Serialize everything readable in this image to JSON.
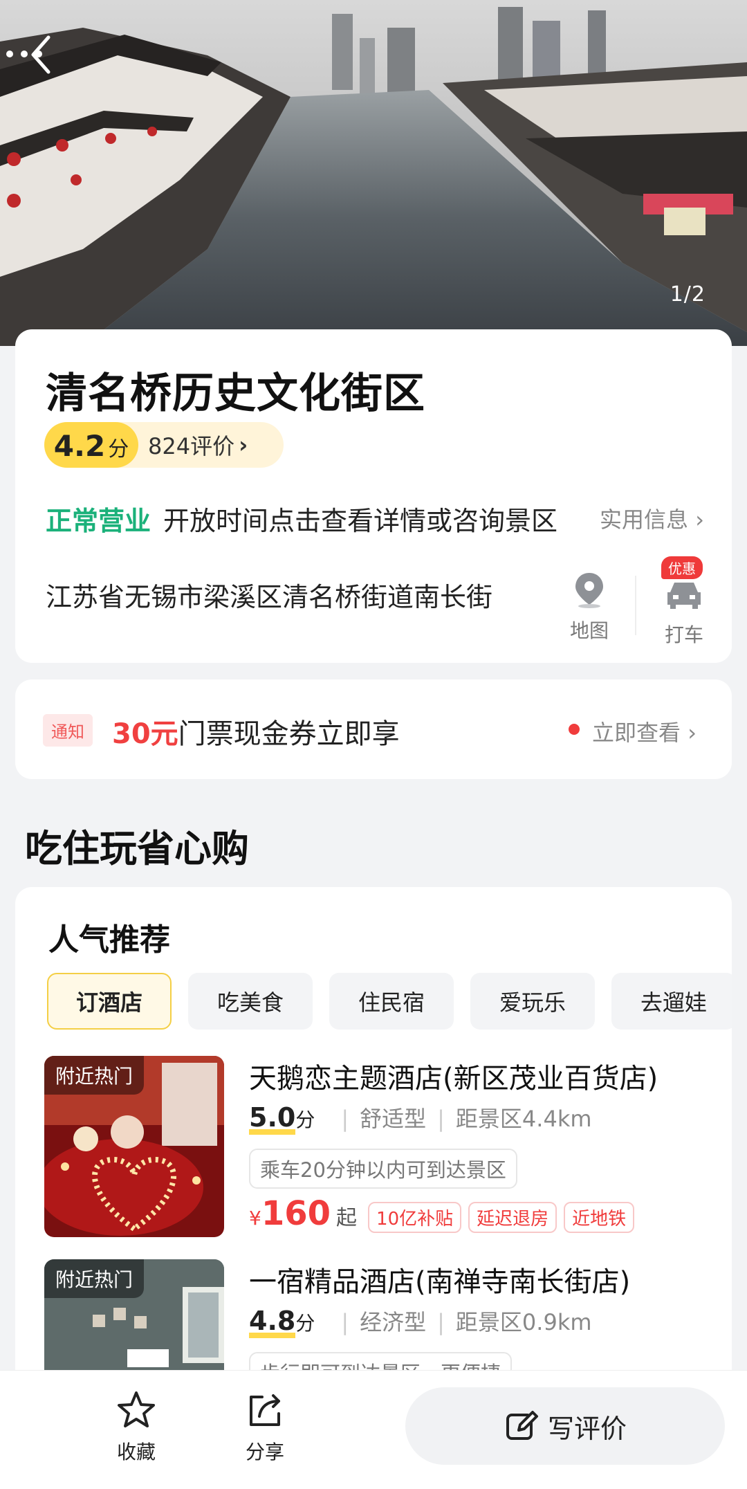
{
  "hero": {
    "counter": "1/2",
    "back_icon": "back-arrow-icon",
    "more_icon": "more-dots-icon"
  },
  "info": {
    "title": "清名桥历史文化街区",
    "rating": "4.2",
    "rating_unit": "分",
    "reviews": "824评价",
    "status": "正常营业",
    "hours_text": "开放时间点击查看详情或咨询景区",
    "practical_info": "实用信息",
    "address": "江苏省无锡市梁溪区清名桥街道南长街",
    "map_label": "地图",
    "taxi_label": "打车",
    "taxi_badge": "优惠"
  },
  "notice": {
    "tag": "通知",
    "highlight": "30元",
    "text": "门票现金券立即享",
    "action": "立即查看"
  },
  "section_title": "吃住玩省心购",
  "recommend": {
    "title": "人气推荐",
    "tabs": [
      "订酒店",
      "吃美食",
      "住民宿",
      "爱玩乐",
      "去遛娃"
    ],
    "hotels": [
      {
        "tag": "附近热门",
        "name": "天鹅恋主题酒店(新区茂业百货店)",
        "score": "5.0",
        "score_unit": "分",
        "type": "舒适型",
        "distance": "距景区4.4km",
        "feature": "乘车20分钟以内可到达景区",
        "yen": "¥",
        "price": "160",
        "price_suffix": "起",
        "tags": [
          "10亿补贴",
          "延迟退房",
          "近地铁"
        ]
      },
      {
        "tag": "附近热门",
        "name": "一宿精品酒店(南禅寺南长街店)",
        "score": "4.8",
        "score_unit": "分",
        "type": "经济型",
        "distance": "距景区0.9km",
        "feature": "步行即可到达景区，更便捷"
      }
    ]
  },
  "bottom_bar": {
    "favorite": "收藏",
    "share": "分享",
    "write_review": "写评价"
  },
  "colors": {
    "accent_yellow": "#ffd84a",
    "status_green": "#1bb17a",
    "price_red": "#f03c3c"
  }
}
